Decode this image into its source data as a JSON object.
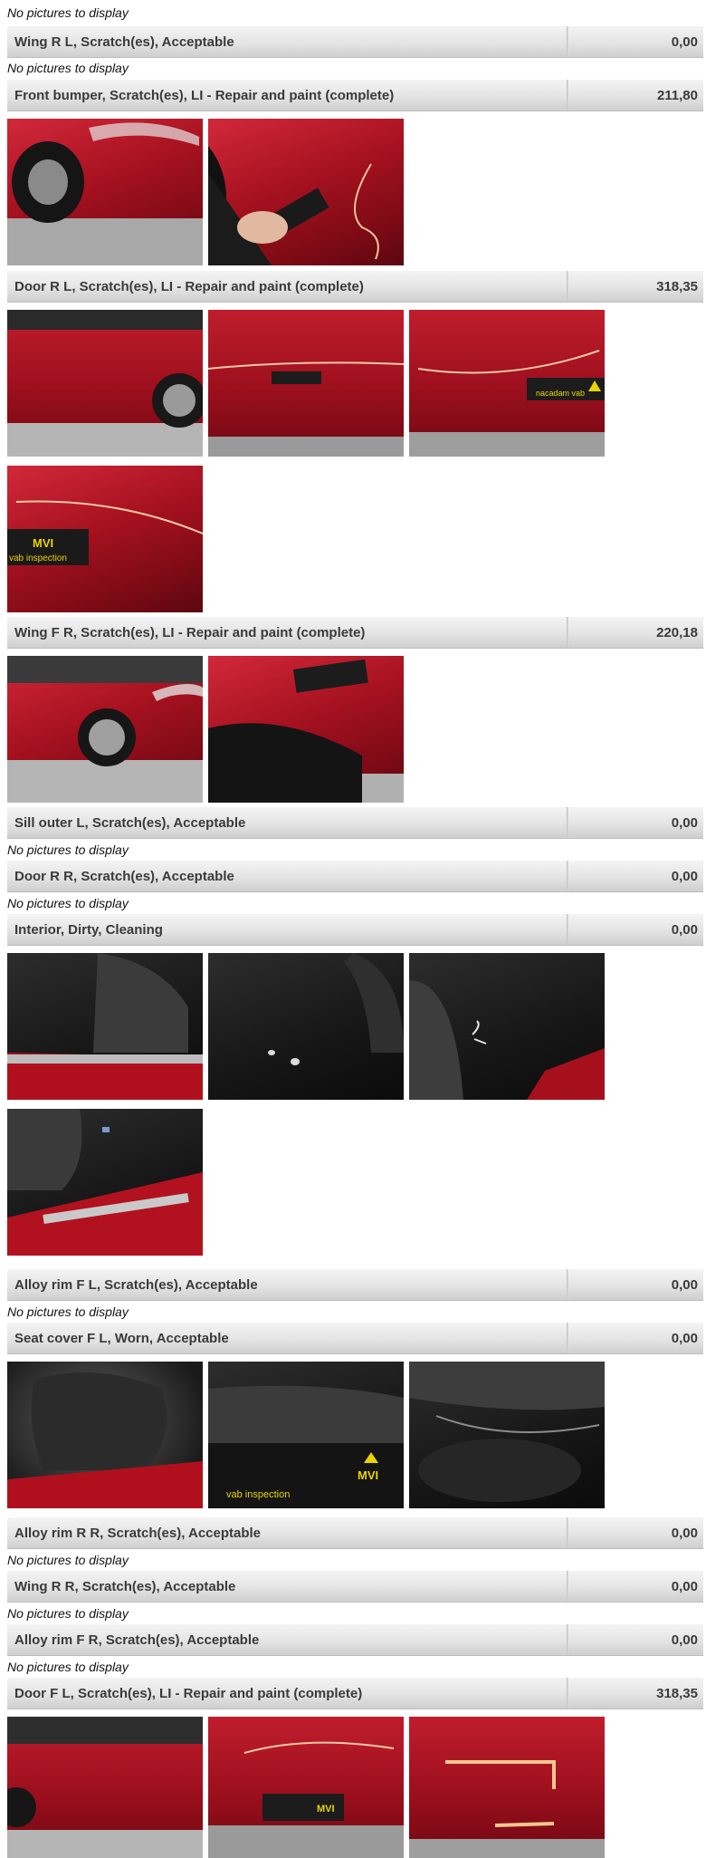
{
  "no_pictures_text": "No pictures to display",
  "rows": [
    {
      "title": "Wing R L, Scratch(es), Acceptable",
      "amount": "0,00"
    },
    {
      "title": "Front bumper, Scratch(es), LI - Repair and paint (complete)",
      "amount": "211,80"
    },
    {
      "title": "Door R L, Scratch(es), LI - Repair and paint (complete)",
      "amount": "318,35"
    },
    {
      "title": "Wing F R, Scratch(es), LI - Repair and paint (complete)",
      "amount": "220,18"
    },
    {
      "title": "Sill outer L, Scratch(es), Acceptable",
      "amount": "0,00"
    },
    {
      "title": "Door R R, Scratch(es), Acceptable",
      "amount": "0,00"
    },
    {
      "title": "Interior, Dirty, Cleaning",
      "amount": "0,00"
    },
    {
      "title": "Alloy rim F L, Scratch(es), Acceptable",
      "amount": "0,00"
    },
    {
      "title": "Seat cover F L, Worn, Acceptable",
      "amount": "0,00"
    },
    {
      "title": "Alloy rim R R, Scratch(es), Acceptable",
      "amount": "0,00"
    },
    {
      "title": "Wing R R, Scratch(es), Acceptable",
      "amount": "0,00"
    },
    {
      "title": "Alloy rim F R, Scratch(es), Acceptable",
      "amount": "0,00"
    },
    {
      "title": "Door F L, Scratch(es), LI - Repair and paint (complete)",
      "amount": "318,35"
    }
  ],
  "photo_ruler_text": "vab inspection",
  "photo_logo_text": "MVI"
}
